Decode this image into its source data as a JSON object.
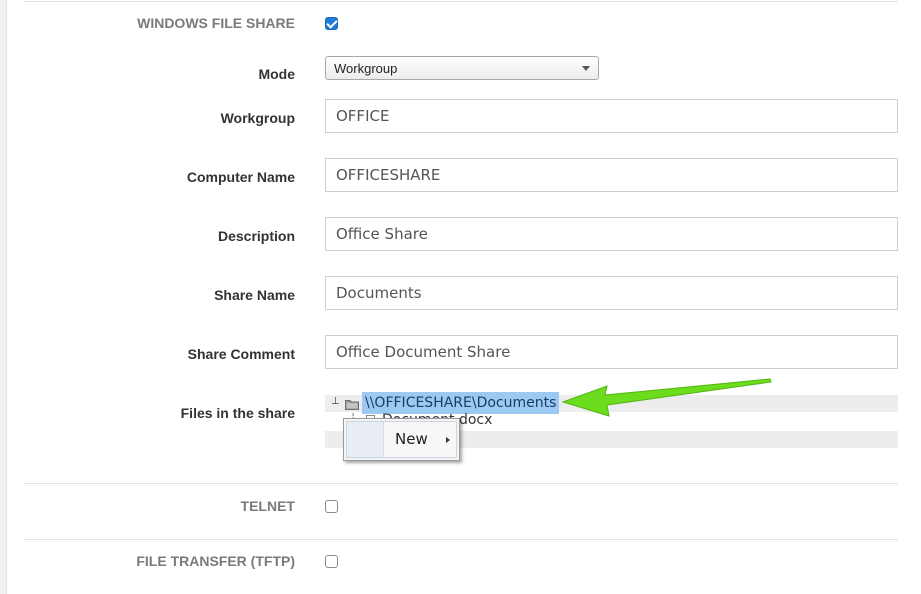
{
  "sections": {
    "windows_file_share": {
      "label": "WINDOWS FILE SHARE",
      "enabled": true
    },
    "telnet": {
      "label": "TELNET",
      "enabled": false
    },
    "tftp": {
      "label": "FILE TRANSFER (TFTP)",
      "enabled": false
    }
  },
  "fields": {
    "mode": {
      "label": "Mode",
      "value": "Workgroup"
    },
    "workgroup": {
      "label": "Workgroup",
      "value": "OFFICE"
    },
    "computer_name": {
      "label": "Computer Name",
      "value": "OFFICESHARE"
    },
    "description": {
      "label": "Description",
      "value": "Office Share"
    },
    "share_name": {
      "label": "Share Name",
      "value": "Documents"
    },
    "share_comment": {
      "label": "Share Comment",
      "value": "Office Document Share"
    }
  },
  "files": {
    "label": "Files in the share",
    "root": "\\\\OFFICESHARE\\Documents",
    "child": "Document.docx",
    "expander": "⊥"
  },
  "context_menu": {
    "items": [
      {
        "label": "New",
        "has_submenu": true
      }
    ]
  },
  "colors": {
    "accent": "#1e7bd6",
    "selection": "#9cc9f2",
    "annotation": "#6cdc1e"
  },
  "icons": {
    "folder": "folder-icon",
    "file": "file-icon",
    "checkbox": "checkbox-icon",
    "caret": "chevron-down-icon",
    "submenu": "chevron-right-icon",
    "annotation": "green-arrow-icon"
  }
}
